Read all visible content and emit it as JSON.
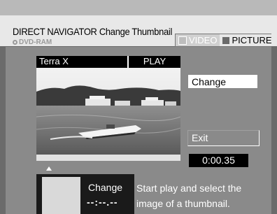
{
  "header": {
    "title": "DIRECT NAVIGATOR  Change Thumbnail",
    "media": "DVD-RAM",
    "modes": {
      "video": "VIDEO",
      "picture": "PICTURE",
      "selected": "PICTURE"
    }
  },
  "player": {
    "title": "Terra X",
    "status": "PLAY",
    "time": "0:00.35"
  },
  "menu": {
    "change": "Change",
    "exit": "Exit"
  },
  "thumbnail": {
    "label": "Change",
    "time": "--:--.--"
  },
  "help": "Start play and select the image of a thumbnail.",
  "colors": {
    "panel": "#8a8a8a",
    "header": "#e8e8e8",
    "accent_dark": "#000000"
  }
}
